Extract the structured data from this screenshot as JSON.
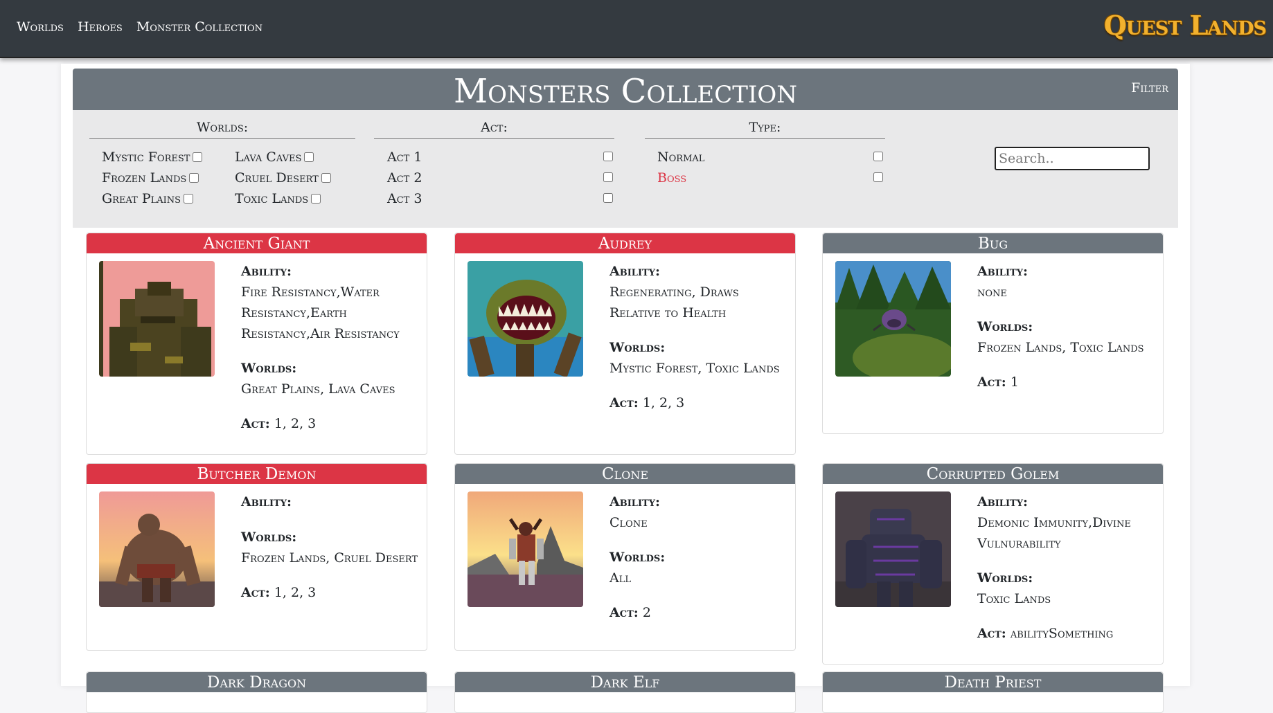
{
  "nav": {
    "links": [
      "Worlds",
      "Heroes",
      "Monster Collection"
    ],
    "brand": "Quest Lands"
  },
  "page": {
    "title": "Monsters Collection",
    "filter_label": "Filter"
  },
  "filters": {
    "worlds": {
      "heading": "Worlds:",
      "options": [
        "Mystic Forest",
        "Frozen Lands",
        "Great Plains",
        "Lava Caves",
        "Cruel Desert",
        "Toxic Lands"
      ]
    },
    "act": {
      "heading": "Act:",
      "options": [
        "Act 1",
        "Act 2",
        "Act 3"
      ]
    },
    "type": {
      "heading": "Type:",
      "options": [
        "Normal",
        "Boss"
      ]
    },
    "search_placeholder": "Search.."
  },
  "labels": {
    "ability": "Ability:",
    "worlds": "Worlds:",
    "act": "Act:"
  },
  "colors": {
    "navbar": "#343a40",
    "boss": "#dc3545",
    "normal": "#6c757d",
    "brand": "#f2b12e"
  },
  "monsters": [
    {
      "name": "Ancient Giant",
      "type": "boss",
      "ability": "Fire Resistancy,Water Resistancy,Earth Resistancy,Air Resistancy",
      "worlds": "Great Plains, Lava Caves",
      "act": "1, 2, 3"
    },
    {
      "name": "Audrey",
      "type": "boss",
      "ability": "Regenerating, Draws Relative to Health",
      "worlds": "Mystic Forest, Toxic Lands",
      "act": "1, 2, 3"
    },
    {
      "name": "Bug",
      "type": "normal",
      "ability": "none",
      "worlds": "Frozen Lands, Toxic Lands",
      "act": "1"
    },
    {
      "name": "Butcher Demon",
      "type": "boss",
      "ability": "",
      "worlds": "Frozen Lands, Cruel Desert",
      "act": "1, 2, 3"
    },
    {
      "name": "Clone",
      "type": "normal",
      "ability": "Clone",
      "worlds": "All",
      "act": "2"
    },
    {
      "name": "Corrupted Golem",
      "type": "normal",
      "ability": "Demonic Immunity,Divine Vulnurability",
      "worlds": "Toxic Lands",
      "act": "abilitySomething"
    },
    {
      "name": "Dark Dragon",
      "type": "normal"
    },
    {
      "name": "Dark Elf",
      "type": "normal"
    },
    {
      "name": "Death Priest",
      "type": "normal"
    }
  ]
}
